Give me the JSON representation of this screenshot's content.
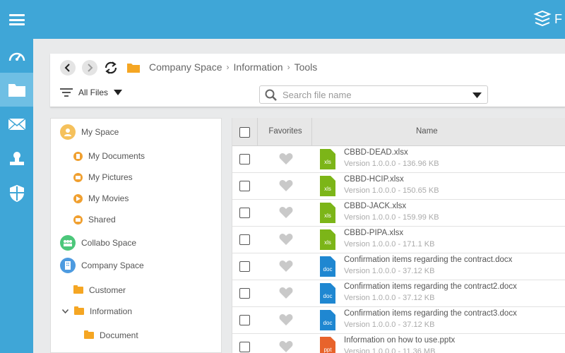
{
  "app": {
    "logo_text": "F"
  },
  "sidebar": {
    "items": [
      {
        "icon": "dashboard-icon"
      },
      {
        "icon": "folder-icon",
        "active": true
      },
      {
        "icon": "mail-icon"
      },
      {
        "icon": "user-icon"
      },
      {
        "icon": "shield-icon"
      }
    ]
  },
  "toolbar": {
    "breadcrumb": [
      "Company Space",
      "Information",
      "Tools"
    ],
    "filter_label": "All Files",
    "search_placeholder": "Search file name"
  },
  "tree": {
    "my_space": "My Space",
    "my_documents": "My Documents",
    "my_pictures": "My Pictures",
    "my_movies": "My Movies",
    "shared": "Shared",
    "collabo_space": "Collabo Space",
    "company_space": "Company Space",
    "customer": "Customer",
    "information": "Information",
    "document": "Document"
  },
  "grid": {
    "col_favorites": "Favorites",
    "col_name": "Name",
    "files": [
      {
        "name": "CBBD-DEAD.xlsx",
        "meta": "Version 1.0.0.0 - 136.96 KB",
        "type": "xls",
        "color": "#7cb518"
      },
      {
        "name": "CBBD-HCIP.xlsx",
        "meta": "Version 1.0.0.0 - 150.65 KB",
        "type": "xls",
        "color": "#7cb518"
      },
      {
        "name": "CBBD-JACK.xlsx",
        "meta": "Version 1.0.0.0 - 159.99 KB",
        "type": "xls",
        "color": "#7cb518"
      },
      {
        "name": "CBBD-PIPA.xlsx",
        "meta": "Version 1.0.0.0 - 171.1 KB",
        "type": "xls",
        "color": "#7cb518"
      },
      {
        "name": "Confirmation items regarding the contract.docx",
        "meta": "Version 1.0.0.0 - 37.12 KB",
        "type": "doc",
        "color": "#1f87d1"
      },
      {
        "name": "Confirmation items regarding the contract2.docx",
        "meta": "Version 1.0.0.0 - 37.12 KB",
        "type": "doc",
        "color": "#1f87d1"
      },
      {
        "name": "Confirmation items regarding the contract3.docx",
        "meta": "Version 1.0.0.0 - 37.12 KB",
        "type": "doc",
        "color": "#1f87d1"
      },
      {
        "name": "Information on how to use.pptx",
        "meta": "Version 1.0.0.0 - 11.36 MB",
        "type": "ppt",
        "color": "#e8632b"
      }
    ]
  }
}
